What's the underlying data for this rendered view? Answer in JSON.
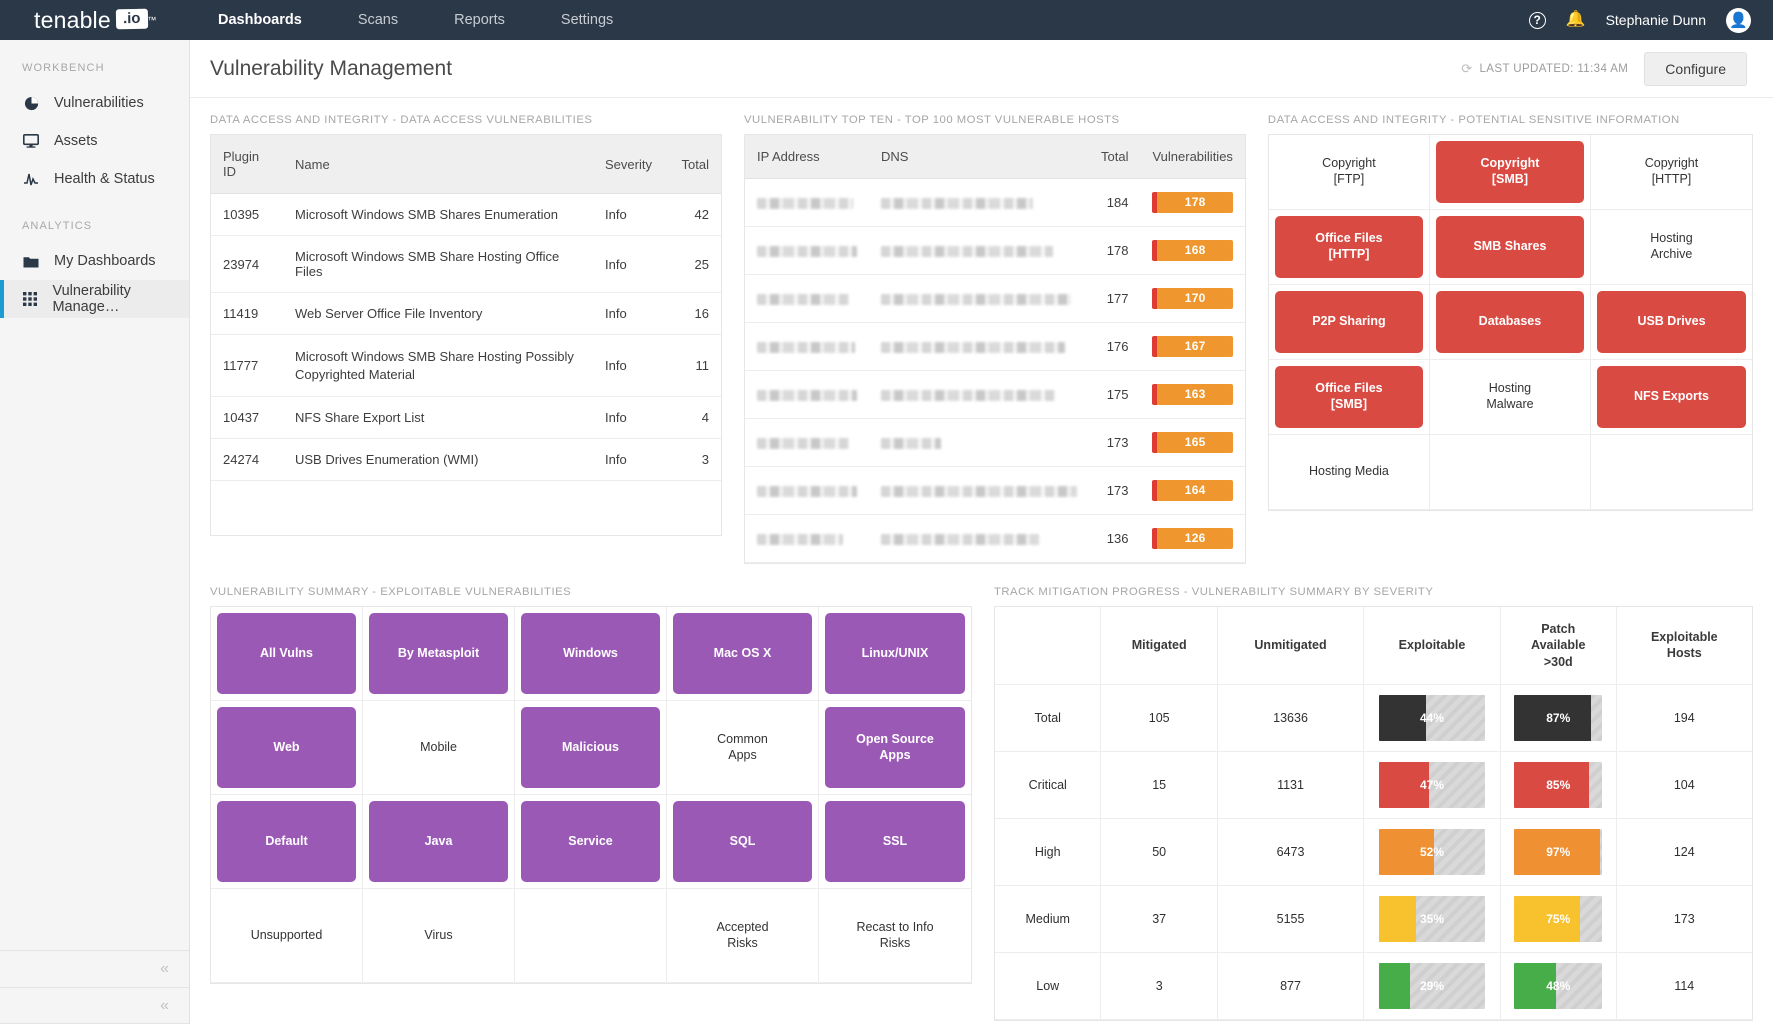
{
  "topnav": {
    "brand_text": "tenable",
    "brand_io": ".io",
    "brand_tm": "™",
    "links": [
      {
        "label": "Dashboards",
        "active": true
      },
      {
        "label": "Scans",
        "active": false
      },
      {
        "label": "Reports",
        "active": false
      },
      {
        "label": "Settings",
        "active": false
      }
    ],
    "help_icon": "question-icon",
    "bell_icon": "notification-bell-icon",
    "username": "Stephanie Dunn",
    "avatar_icon": "user-avatar-icon"
  },
  "sidebar": {
    "groups": [
      {
        "label": "WORKBENCH",
        "items": [
          {
            "label": "Vulnerabilities",
            "icon": "pie-chart-icon",
            "active": false
          },
          {
            "label": "Assets",
            "icon": "monitor-icon",
            "active": false
          },
          {
            "label": "Health & Status",
            "icon": "pulse-icon",
            "active": false
          }
        ]
      },
      {
        "label": "ANALYTICS",
        "items": [
          {
            "label": "My Dashboards",
            "icon": "folder-icon",
            "active": false
          },
          {
            "label": "Vulnerability Manage…",
            "icon": "grid-icon",
            "active": true
          }
        ]
      }
    ],
    "collapse_icon": "chevron-double-left-icon"
  },
  "header": {
    "title": "Vulnerability Management",
    "last_updated": "LAST UPDATED: 11:34 AM",
    "refresh_icon": "refresh-icon",
    "configure_label": "Configure"
  },
  "data_access_panel": {
    "title": "DATA ACCESS AND INTEGRITY - DATA ACCESS VULNERABILITIES",
    "columns": [
      "Plugin ID",
      "Name",
      "Severity",
      "Total"
    ],
    "rows": [
      {
        "plugin_id": "10395",
        "name": "Microsoft Windows SMB Shares Enumeration",
        "severity": "Info",
        "total": "42"
      },
      {
        "plugin_id": "23974",
        "name": "Microsoft Windows SMB Share Hosting Office Files",
        "severity": "Info",
        "total": "25"
      },
      {
        "plugin_id": "11419",
        "name": "Web Server Office File Inventory",
        "severity": "Info",
        "total": "16"
      },
      {
        "plugin_id": "11777",
        "name": "Microsoft Windows SMB Share Hosting Possibly Copyrighted Material",
        "severity": "Info",
        "total": "11"
      },
      {
        "plugin_id": "10437",
        "name": "NFS Share Export List",
        "severity": "Info",
        "total": "4"
      },
      {
        "plugin_id": "24274",
        "name": "USB Drives Enumeration (WMI)",
        "severity": "Info",
        "total": "3"
      }
    ]
  },
  "top_ten_panel": {
    "title": "VULNERABILITY TOP TEN - TOP 100 MOST VULNERABLE HOSTS",
    "columns": [
      "IP Address",
      "DNS",
      "Total",
      "Vulnerabilities"
    ],
    "rows": [
      {
        "ip": "[redacted]",
        "ip_width": 96,
        "dns": "[redacted]",
        "dns_width": 152,
        "total": "184",
        "vulnerabilities": "178"
      },
      {
        "ip": "[redacted]",
        "ip_width": 100,
        "dns": "[redacted]",
        "dns_width": 172,
        "total": "178",
        "vulnerabilities": "168"
      },
      {
        "ip": "[redacted]",
        "ip_width": 92,
        "dns": "[redacted]",
        "dns_width": 190,
        "total": "177",
        "vulnerabilities": "170"
      },
      {
        "ip": "[redacted]",
        "ip_width": 98,
        "dns": "[redacted]",
        "dns_width": 184,
        "total": "176",
        "vulnerabilities": "167"
      },
      {
        "ip": "[redacted]",
        "ip_width": 100,
        "dns": "[redacted]",
        "dns_width": 174,
        "total": "175",
        "vulnerabilities": "163"
      },
      {
        "ip": "[redacted]",
        "ip_width": 92,
        "dns": "[redacted]",
        "dns_width": 60,
        "total": "173",
        "vulnerabilities": "165"
      },
      {
        "ip": "[redacted]",
        "ip_width": 100,
        "dns": "[redacted]",
        "dns_width": 196,
        "total": "173",
        "vulnerabilities": "164"
      },
      {
        "ip": "[redacted]",
        "ip_width": 86,
        "dns": "[redacted]",
        "dns_width": 158,
        "total": "136",
        "vulnerabilities": "126"
      }
    ]
  },
  "sensitive_panel": {
    "title": "DATA ACCESS AND INTEGRITY - POTENTIAL SENSITIVE INFORMATION",
    "accent_color": "#d94a43",
    "cells": [
      {
        "label": "Copyright\n[FTP]",
        "filled": false
      },
      {
        "label": "Copyright\n[SMB]",
        "filled": true
      },
      {
        "label": "Copyright\n[HTTP]",
        "filled": false
      },
      {
        "label": "Office Files\n[HTTP]",
        "filled": true
      },
      {
        "label": "SMB Shares",
        "filled": true
      },
      {
        "label": "Hosting\nArchive",
        "filled": false
      },
      {
        "label": "P2P Sharing",
        "filled": true
      },
      {
        "label": "Databases",
        "filled": true
      },
      {
        "label": "USB Drives",
        "filled": true
      },
      {
        "label": "Office Files\n[SMB]",
        "filled": true
      },
      {
        "label": "Hosting\nMalware",
        "filled": false
      },
      {
        "label": "NFS Exports",
        "filled": true
      },
      {
        "label": "Hosting Media",
        "filled": false
      },
      {
        "label": "",
        "filled": false
      },
      {
        "label": "",
        "filled": false
      }
    ]
  },
  "exploitable_panel": {
    "title": "VULNERABILITY SUMMARY - EXPLOITABLE VULNERABILITIES",
    "accent_color": "#9b59b6",
    "cells": [
      {
        "label": "All Vulns",
        "filled": true
      },
      {
        "label": "By Metasploit",
        "filled": true
      },
      {
        "label": "Windows",
        "filled": true
      },
      {
        "label": "Mac OS X",
        "filled": true
      },
      {
        "label": "Linux/UNIX",
        "filled": true
      },
      {
        "label": "Web",
        "filled": true
      },
      {
        "label": "Mobile",
        "filled": false
      },
      {
        "label": "Malicious",
        "filled": true
      },
      {
        "label": "Common\nApps",
        "filled": false
      },
      {
        "label": "Open Source\nApps",
        "filled": true
      },
      {
        "label": "Default",
        "filled": true
      },
      {
        "label": "Java",
        "filled": true
      },
      {
        "label": "Service",
        "filled": true
      },
      {
        "label": "SQL",
        "filled": true
      },
      {
        "label": "SSL",
        "filled": true
      },
      {
        "label": "Unsupported",
        "filled": false
      },
      {
        "label": "Virus",
        "filled": false
      },
      {
        "label": "",
        "filled": false
      },
      {
        "label": "Accepted\nRisks",
        "filled": false
      },
      {
        "label": "Recast to Info\nRisks",
        "filled": false
      }
    ]
  },
  "mitigation_panel": {
    "title": "TRACK MITIGATION PROGRESS - VULNERABILITY SUMMARY BY SEVERITY",
    "columns": [
      "",
      "Mitigated",
      "Unmitigated",
      "Exploitable",
      "Patch\nAvailable\n>30d",
      "Exploitable\nHosts"
    ],
    "rows": [
      {
        "severity": "Total",
        "mitigated": "105",
        "unmitigated": "13636",
        "exploitable_pct": "44%",
        "exploitable_value": 44,
        "patch_pct": "87%",
        "patch_value": 87,
        "hosts": "194",
        "color": "#333333"
      },
      {
        "severity": "Critical",
        "mitigated": "15",
        "unmitigated": "1131",
        "exploitable_pct": "47%",
        "exploitable_value": 47,
        "patch_pct": "85%",
        "patch_value": 85,
        "hosts": "104",
        "color": "#d94a43"
      },
      {
        "severity": "High",
        "mitigated": "50",
        "unmitigated": "6473",
        "exploitable_pct": "52%",
        "exploitable_value": 52,
        "patch_pct": "97%",
        "patch_value": 97,
        "hosts": "124",
        "color": "#ef9033"
      },
      {
        "severity": "Medium",
        "mitigated": "37",
        "unmitigated": "5155",
        "exploitable_pct": "35%",
        "exploitable_value": 35,
        "patch_pct": "75%",
        "patch_value": 75,
        "hosts": "173",
        "color": "#f7c22e"
      },
      {
        "severity": "Low",
        "mitigated": "3",
        "unmitigated": "877",
        "exploitable_pct": "29%",
        "exploitable_value": 29,
        "patch_pct": "48%",
        "patch_value": 48,
        "hosts": "114",
        "color": "#46ad49"
      }
    ]
  }
}
